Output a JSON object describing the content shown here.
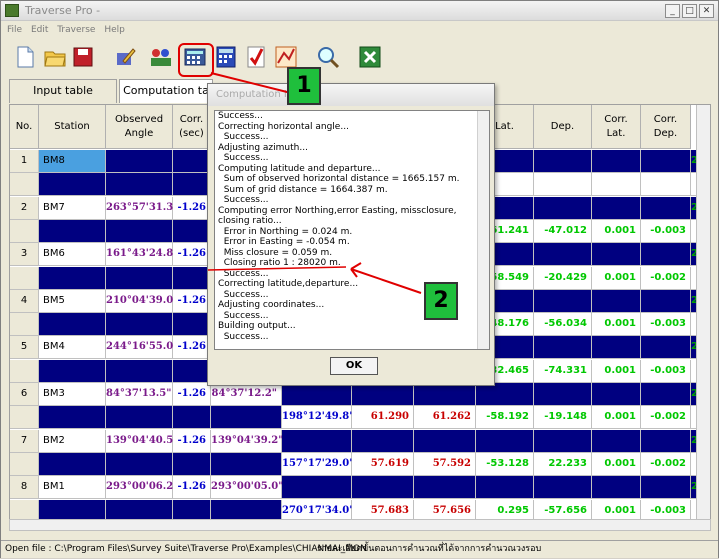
{
  "window": {
    "title": "Traverse Pro -"
  },
  "menu": [
    "File",
    "Edit",
    "Traverse",
    "Help"
  ],
  "toolbar": {
    "icons": [
      "new-file-icon",
      "open-folder-icon",
      "save-icon",
      "edit-icon",
      "people-icon",
      "calculator-icon",
      "calculator-icon",
      "checklist-icon",
      "chart-icon",
      "zoom-icon",
      "excel-icon"
    ]
  },
  "tabs": [
    "Input table",
    "Computation ta"
  ],
  "table": {
    "headers": [
      "No.",
      "Station",
      "Observed\nAngle",
      "Corr.\n(sec)",
      "",
      "",
      "",
      "",
      "Lat.",
      "Dep.",
      "Corr.\nLat.",
      "Corr.\nDep.",
      ""
    ],
    "rows": [
      {
        "no": "1",
        "station": "BM8",
        "angle": "",
        "corr": "",
        "adj": "",
        "az": "",
        "d1": "",
        "d2": "",
        "lat": "",
        "dep": "",
        "clat": "",
        "cdep": ""
      },
      {
        "no": "",
        "station": "",
        "angle": "",
        "corr": "",
        "adj": "",
        "az": "",
        "d1": "",
        "d2": "",
        "lat": "",
        "dep": "",
        "clat": "",
        "cdep": ""
      },
      {
        "no": "2",
        "station": "BM7",
        "angle": "263°57'31.3\"",
        "corr": "-1.26",
        "adj": "",
        "az": "",
        "d1": "",
        "d2": "",
        "lat": "",
        "dep": "",
        "clat": "",
        "cdep": ""
      },
      {
        "no": "",
        "station": "",
        "angle": "",
        "corr": "",
        "adj": "",
        "az": "",
        "d1": "",
        "d2": "",
        "lat": "61.241",
        "dep": "-47.012",
        "clat": "0.001",
        "cdep": "-0.003"
      },
      {
        "no": "3",
        "station": "BM6",
        "angle": "161°43'24.8\"",
        "corr": "-1.26",
        "adj": "",
        "az": "",
        "d1": "",
        "d2": "",
        "lat": "",
        "dep": "",
        "clat": "",
        "cdep": ""
      },
      {
        "no": "",
        "station": "",
        "angle": "",
        "corr": "",
        "adj": "",
        "az": "",
        "d1": "",
        "d2": "",
        "lat": "-58.549",
        "dep": "-20.429",
        "clat": "0.001",
        "cdep": "-0.002"
      },
      {
        "no": "4",
        "station": "BM5",
        "angle": "210°04'39.0\"",
        "corr": "-1.26",
        "adj": "",
        "az": "",
        "d1": "",
        "d2": "",
        "lat": "",
        "dep": "",
        "clat": "",
        "cdep": ""
      },
      {
        "no": "",
        "station": "",
        "angle": "",
        "corr": "",
        "adj": "",
        "az": "",
        "d1": "",
        "d2": "",
        "lat": "48.176",
        "dep": "-56.034",
        "clat": "0.001",
        "cdep": "-0.003"
      },
      {
        "no": "5",
        "station": "BM4",
        "angle": "244°16'55.0\"",
        "corr": "-1.26",
        "adj": "",
        "az": "",
        "d1": "",
        "d2": "",
        "lat": "",
        "dep": "",
        "clat": "",
        "cdep": ""
      },
      {
        "no": "",
        "station": "",
        "angle": "",
        "corr": "",
        "adj": "",
        "az": "",
        "d1": "",
        "d2": "",
        "lat": "32.465",
        "dep": "-74.331",
        "clat": "0.001",
        "cdep": "-0.003"
      },
      {
        "no": "6",
        "station": "BM3",
        "angle": "84°37'13.5\"",
        "corr": "-1.26",
        "adj": "84°37'12.2\"",
        "az": "",
        "d1": "",
        "d2": "",
        "lat": "",
        "dep": "",
        "clat": "",
        "cdep": ""
      },
      {
        "no": "",
        "station": "",
        "angle": "",
        "corr": "",
        "adj": "",
        "az": "198°12'49.8\"",
        "d1": "61.290",
        "d2": "61.262",
        "lat": "-58.192",
        "dep": "-19.148",
        "clat": "0.001",
        "cdep": "-0.002"
      },
      {
        "no": "7",
        "station": "BM2",
        "angle": "139°04'40.5\"",
        "corr": "-1.26",
        "adj": "139°04'39.2\"",
        "az": "",
        "d1": "",
        "d2": "",
        "lat": "",
        "dep": "",
        "clat": "",
        "cdep": ""
      },
      {
        "no": "",
        "station": "",
        "angle": "",
        "corr": "",
        "adj": "",
        "az": "157°17'29.0\"",
        "d1": "57.619",
        "d2": "57.592",
        "lat": "-53.128",
        "dep": "22.233",
        "clat": "0.001",
        "cdep": "-0.002"
      },
      {
        "no": "8",
        "station": "BM1",
        "angle": "293°00'06.2\"",
        "corr": "-1.26",
        "adj": "293°00'05.0\"",
        "az": "",
        "d1": "",
        "d2": "",
        "lat": "",
        "dep": "",
        "clat": "",
        "cdep": ""
      },
      {
        "no": "",
        "station": "",
        "angle": "",
        "corr": "",
        "adj": "",
        "az": "270°17'34.0\"",
        "d1": "57.683",
        "d2": "57.656",
        "lat": "0.295",
        "dep": "-57.656",
        "clat": "0.001",
        "cdep": "-0.003"
      }
    ],
    "right_edge_values": [
      "2",
      "2",
      "2",
      "2",
      "2",
      "2",
      "2",
      "2"
    ]
  },
  "dialog": {
    "title": "Computation Inf",
    "log": [
      "Success...",
      "Correcting horizontal angle...",
      "  Success...",
      "Adjusting azimuth...",
      "  Success...",
      "Computing latitude and departure...",
      "  Sum of observed horizontal distance = 1665.157 m.",
      "  Sum of grid distance = 1664.387 m.",
      "  Success...",
      "Computing error Northing,error Easting, missclosure,",
      "closing ratio...",
      "  Error in Northing = 0.024 m.",
      "  Error in Easting = -0.054 m.",
      "  Miss closure = 0.059 m.",
      "  Closing ratio 1 : 28020 m.",
      "  Success...",
      "Correcting latitude,departure...",
      "  Success...",
      "Adjusting coordinates...",
      "  Success...",
      "Building output...",
      "  Success..."
    ],
    "ok": "OK"
  },
  "callouts": [
    "1",
    "2"
  ],
  "status": "Open file : C:\\Program Files\\Survey Suite\\Traverse Pro\\Examples\\CHIANMAI_MON",
  "status_thai": "รายละเอียดขั้นตอนการคำนวณที่ได้จากการคำนวณวงรอบ"
}
